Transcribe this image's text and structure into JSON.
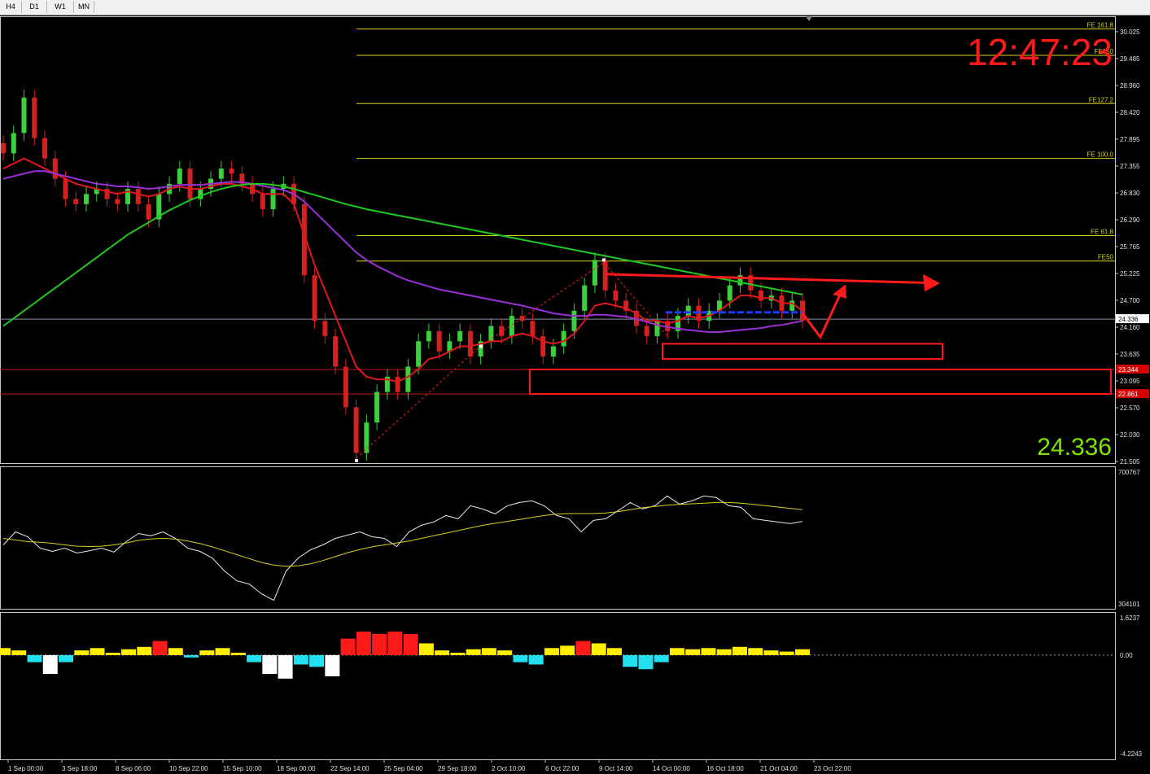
{
  "toolbar": {
    "timeframes": [
      "H4",
      "D1",
      "W1",
      "MN"
    ]
  },
  "colors": {
    "background": "#000000",
    "bull_candle": "#3bd13b",
    "bear_candle": "#d32020",
    "ma_fast": "#e0181c",
    "ma_mid": "#9b2fd6",
    "ma_slow": "#1fc81f",
    "fib_line": "#d8d020",
    "price_line": "#7f8fb0",
    "annotation": "#ff1a1a",
    "oscillator_line": "#e8e8e8",
    "oscillator_signal": "#d8d020"
  },
  "overlay": {
    "clock": "12:47:23",
    "last_price_big": "24.336"
  },
  "price_axis": {
    "labels": [
      "30.025",
      "29.485",
      "28.960",
      "28.420",
      "27.895",
      "27.355",
      "26.830",
      "26.290",
      "25.765",
      "25.225",
      "24.700",
      "24.160",
      "23.635",
      "23.095",
      "22.570",
      "22.030",
      "21.505"
    ],
    "tags": [
      {
        "text": "24.336",
        "value": 24.336,
        "bg": "#ffffff",
        "fg": "#000000"
      },
      {
        "text": "23.344",
        "value": 23.344,
        "bg": "#d40000",
        "fg": "#ffffff"
      },
      {
        "text": "22.861",
        "value": 22.861,
        "bg": "#d40000",
        "fg": "#ffffff"
      }
    ]
  },
  "fib_levels": [
    {
      "label": "FE 161.8",
      "value": 30.05
    },
    {
      "label": "FE150",
      "value": 29.53
    },
    {
      "label": "FE127.2",
      "value": 28.58
    },
    {
      "label": "FE 100.0",
      "value": 27.5
    },
    {
      "label": "FE 61.8",
      "value": 25.98
    },
    {
      "label": "FE50",
      "value": 25.48
    }
  ],
  "horizontal_lines": [
    {
      "value": 24.336,
      "color": "#7f8fb0"
    },
    {
      "value": 23.344,
      "color": "#c01818"
    },
    {
      "value": 22.861,
      "color": "#c01818"
    }
  ],
  "time_axis": [
    "1 Sep 00:00",
    "3 Sep 18:00",
    "8 Sep 06:00",
    "10 Sep 22:00",
    "15 Sep 10:00",
    "18 Sep 00:00",
    "22 Sep 14:00",
    "25 Sep 04:00",
    "29 Sep 18:00",
    "2 Oct 10:00",
    "6 Oct 22:00",
    "9 Oct 14:00",
    "14 Oct 00:00",
    "16 Oct 18:00",
    "21 Oct 04:00",
    "23 Oct 22:00"
  ],
  "sub1": {
    "max_label": "700767",
    "min_label": "304101"
  },
  "sub2": {
    "max_label": "1.6237",
    "zero_label": "0.00",
    "min_label": "-4.2243"
  },
  "chart_data": [
    {
      "type": "line",
      "title": "",
      "ylim": [
        21.5,
        30.3
      ],
      "series": [
        {
          "name": "",
          "role": "close",
          "values": [
            27.6,
            28.0,
            28.7,
            27.9,
            27.5,
            27.1,
            26.7,
            26.6,
            26.8,
            26.9,
            26.7,
            26.6,
            26.9,
            26.6,
            26.3,
            26.8,
            27.0,
            27.3,
            26.7,
            26.9,
            27.1,
            27.3,
            27.2,
            27.0,
            26.8,
            26.5,
            26.9,
            27.0,
            26.6,
            25.2,
            24.3,
            24.0,
            23.4,
            22.6,
            21.7,
            22.3,
            22.9,
            23.2,
            22.9,
            23.4,
            23.9,
            24.1,
            23.7,
            23.9,
            24.1,
            23.6,
            23.9,
            24.2,
            24.0,
            24.4,
            24.3,
            24.0,
            23.6,
            23.8,
            24.1,
            24.5,
            25.0,
            25.5,
            24.9,
            24.7,
            24.5,
            24.2,
            24.0,
            24.3,
            24.1,
            24.4,
            24.6,
            24.3,
            24.5,
            24.7,
            25.0,
            25.2,
            24.9,
            24.7,
            24.8,
            24.5,
            24.7,
            24.3
          ]
        },
        {
          "name": "",
          "role": "ma_fast",
          "values": [
            27.3,
            27.4,
            27.5,
            27.4,
            27.3,
            27.2,
            27.1,
            27.0,
            26.95,
            26.9,
            26.85,
            26.8,
            26.85,
            26.8,
            26.75,
            26.8,
            26.9,
            26.95,
            26.9,
            26.9,
            26.95,
            27.0,
            27.0,
            26.95,
            26.9,
            26.8,
            26.8,
            26.8,
            26.6,
            26.0,
            25.4,
            24.9,
            24.4,
            23.9,
            23.4,
            23.2,
            23.15,
            23.15,
            23.1,
            23.2,
            23.35,
            23.55,
            23.6,
            23.7,
            23.8,
            23.8,
            23.85,
            23.9,
            23.9,
            24.0,
            24.05,
            24.0,
            23.9,
            23.85,
            23.9,
            24.05,
            24.3,
            24.6,
            24.65,
            24.6,
            24.55,
            24.45,
            24.3,
            24.3,
            24.25,
            24.3,
            24.4,
            24.35,
            24.4,
            24.5,
            24.65,
            24.8,
            24.8,
            24.75,
            24.75,
            24.65,
            24.65,
            24.5
          ]
        },
        {
          "name": "",
          "role": "ma_mid",
          "values": [
            27.1,
            27.15,
            27.2,
            27.25,
            27.25,
            27.2,
            27.15,
            27.1,
            27.05,
            27.0,
            26.98,
            26.95,
            26.95,
            26.93,
            26.9,
            26.92,
            26.95,
            26.98,
            26.98,
            26.98,
            27.0,
            27.02,
            27.04,
            27.03,
            27.0,
            26.96,
            26.92,
            26.88,
            26.8,
            26.65,
            26.45,
            26.25,
            26.05,
            25.85,
            25.65,
            25.5,
            25.38,
            25.28,
            25.18,
            25.1,
            25.04,
            24.98,
            24.92,
            24.88,
            24.84,
            24.8,
            24.76,
            24.72,
            24.68,
            24.64,
            24.6,
            24.55,
            24.5,
            24.45,
            24.42,
            24.4,
            24.4,
            24.42,
            24.42,
            24.4,
            24.38,
            24.34,
            24.28,
            24.22,
            24.18,
            24.15,
            24.12,
            24.1,
            24.08,
            24.08,
            24.1,
            24.12,
            24.14,
            24.16,
            24.2,
            24.22,
            24.26,
            24.3
          ]
        },
        {
          "name": "",
          "role": "ma_slow",
          "values": [
            24.2,
            24.35,
            24.5,
            24.65,
            24.8,
            24.95,
            25.1,
            25.25,
            25.4,
            25.55,
            25.7,
            25.85,
            26.0,
            26.12,
            26.24,
            26.36,
            26.48,
            26.58,
            26.68,
            26.76,
            26.84,
            26.9,
            26.95,
            26.98,
            27.0,
            27.0,
            26.98,
            26.95,
            26.9,
            26.84,
            26.78,
            26.72,
            26.66,
            26.6,
            26.55,
            26.5,
            26.46,
            26.42,
            26.38,
            26.34,
            26.3,
            26.26,
            26.22,
            26.18,
            26.14,
            26.1,
            26.06,
            26.02,
            25.98,
            25.94,
            25.9,
            25.86,
            25.82,
            25.78,
            25.74,
            25.7,
            25.66,
            25.62,
            25.58,
            25.54,
            25.5,
            25.46,
            25.42,
            25.38,
            25.34,
            25.3,
            25.26,
            25.22,
            25.18,
            25.14,
            25.1,
            25.06,
            25.02,
            24.98,
            24.94,
            24.9,
            24.86,
            24.82
          ]
        }
      ]
    },
    {
      "type": "line",
      "title": "",
      "ylim": [
        304101,
        700767
      ],
      "series": [
        {
          "name": "",
          "values": [
            480000,
            520000,
            505000,
            470000,
            460000,
            470000,
            455000,
            462000,
            470000,
            458000,
            490000,
            515000,
            508000,
            520000,
            500000,
            470000,
            460000,
            440000,
            400000,
            370000,
            360000,
            330000,
            310000,
            400000,
            440000,
            465000,
            480000,
            500000,
            510000,
            520000,
            505000,
            500000,
            475000,
            520000,
            540000,
            550000,
            570000,
            560000,
            600000,
            590000,
            575000,
            600000,
            610000,
            615000,
            600000,
            570000,
            560000,
            520000,
            555000,
            560000,
            585000,
            610000,
            590000,
            600000,
            630000,
            605000,
            615000,
            630000,
            625000,
            600000,
            595000,
            560000,
            555000,
            550000,
            545000,
            552000
          ]
        },
        {
          "name": "",
          "values": [
            500000,
            495000,
            490000,
            488000,
            485000,
            480000,
            476000,
            475000,
            476000,
            480000,
            486000,
            494000,
            498000,
            500000,
            498000,
            492000,
            484000,
            474000,
            462000,
            450000,
            438000,
            426000,
            418000,
            414000,
            416000,
            422000,
            432000,
            444000,
            456000,
            466000,
            474000,
            480000,
            486000,
            492000,
            500000,
            508000,
            516000,
            524000,
            532000,
            540000,
            546000,
            552000,
            558000,
            564000,
            570000,
            574000,
            576000,
            576000,
            576000,
            578000,
            582000,
            588000,
            594000,
            598000,
            602000,
            604000,
            606000,
            608000,
            610000,
            610000,
            608000,
            604000,
            600000,
            596000,
            592000,
            588000
          ]
        }
      ]
    },
    {
      "type": "bar",
      "title": "",
      "ylim": [
        -4.2243,
        1.6237
      ],
      "series": [
        {
          "name": "",
          "values": [
            0.3,
            0.2,
            -0.3,
            -0.8,
            -0.3,
            0.2,
            0.3,
            0.1,
            0.25,
            0.35,
            0.6,
            0.3,
            -0.1,
            0.2,
            0.3,
            0.1,
            -0.3,
            -0.8,
            -1.0,
            -0.4,
            -0.5,
            -0.9,
            0.7,
            1.0,
            0.9,
            1.0,
            0.9,
            0.5,
            0.2,
            0.1,
            0.25,
            0.3,
            0.2,
            -0.3,
            -0.4,
            0.3,
            0.4,
            0.6,
            0.5,
            0.3,
            -0.5,
            -0.6,
            -0.3,
            0.3,
            0.25,
            0.3,
            0.25,
            0.35,
            0.3,
            0.2,
            0.15,
            0.25
          ]
        }
      ]
    }
  ]
}
